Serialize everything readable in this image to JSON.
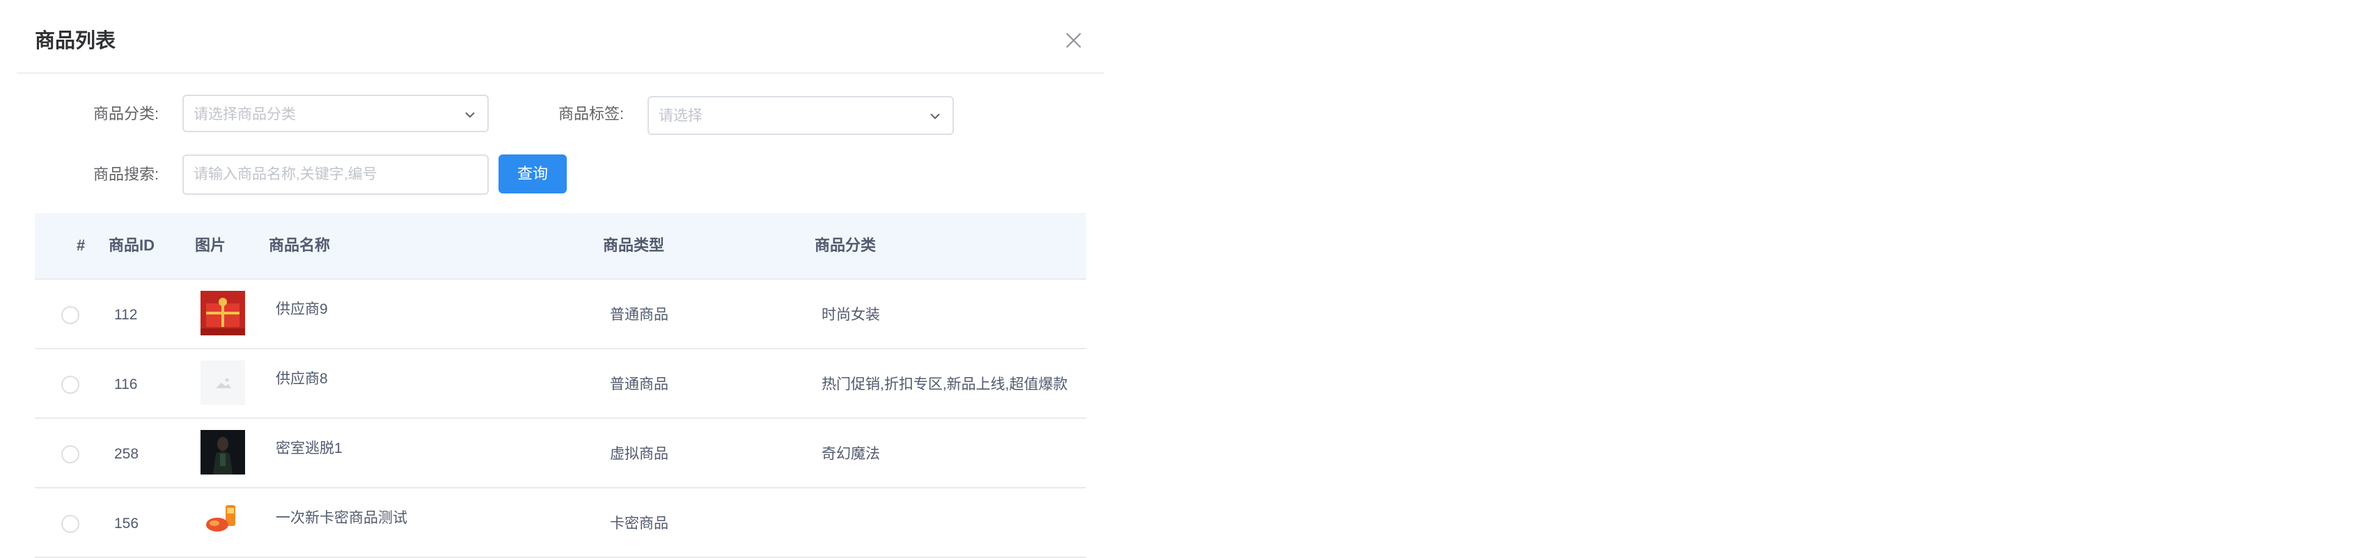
{
  "dialog": {
    "title": "商品列表",
    "close_icon": "close-icon"
  },
  "filters": {
    "category_label": "商品分类:",
    "category_placeholder": "请选择商品分类",
    "tag_label": "商品标签:",
    "tag_placeholder": "请选择",
    "search_label": "商品搜索:",
    "search_placeholder": "请输入商品名称,关键字,编号",
    "query_button": "查询"
  },
  "table": {
    "headers": {
      "index": "#",
      "id": "商品ID",
      "image": "图片",
      "name": "商品名称",
      "type": "商品类型",
      "category": "商品分类"
    },
    "rows": [
      {
        "id": "112",
        "name": "供应商9",
        "type": "普通商品",
        "category": "时尚女装",
        "thumb": "red-gift-box"
      },
      {
        "id": "116",
        "name": "供应商8",
        "type": "普通商品",
        "category": "热门促销,折扣专区,新品上线,超值爆款",
        "thumb": "placeholder-image"
      },
      {
        "id": "258",
        "name": "密室逃脱1",
        "type": "虚拟商品",
        "category": "奇幻魔法",
        "thumb": "dark-portrait"
      },
      {
        "id": "156",
        "name": "一次新卡密商品测试",
        "type": "卡密商品",
        "category": "",
        "thumb": "orange-product"
      }
    ]
  },
  "colors": {
    "primary": "#2d8cf0",
    "header_bg": "#f2f7fd",
    "border": "#e8eaec"
  }
}
